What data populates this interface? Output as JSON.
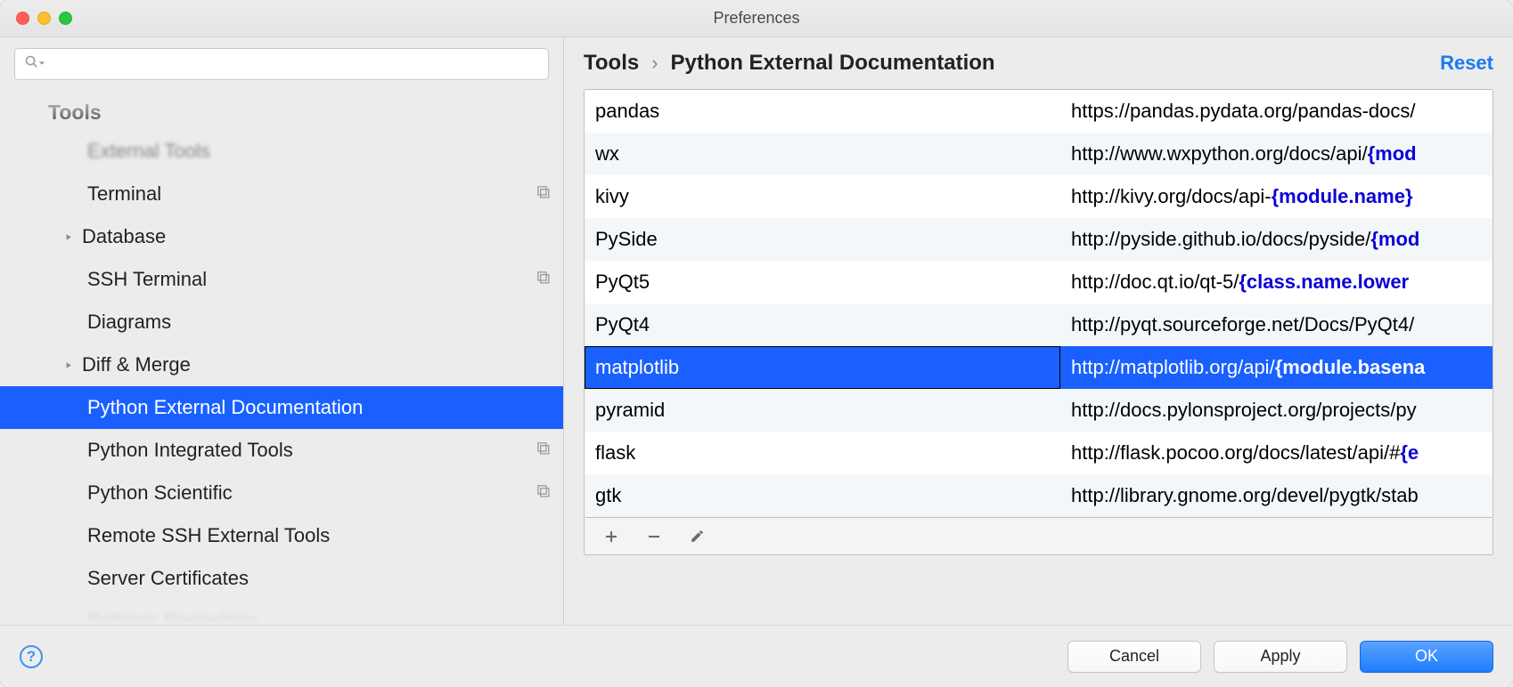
{
  "window": {
    "title": "Preferences"
  },
  "sidebar": {
    "section": "Tools",
    "items": [
      {
        "label": "External Tools",
        "depth": 2,
        "expandable": false,
        "selected": false,
        "scope": false,
        "partial": "top"
      },
      {
        "label": "Terminal",
        "depth": 2,
        "expandable": false,
        "selected": false,
        "scope": true
      },
      {
        "label": "Database",
        "depth": 2,
        "expandable": true,
        "selected": false,
        "scope": false
      },
      {
        "label": "SSH Terminal",
        "depth": 2,
        "expandable": false,
        "selected": false,
        "scope": true
      },
      {
        "label": "Diagrams",
        "depth": 2,
        "expandable": false,
        "selected": false,
        "scope": false
      },
      {
        "label": "Diff & Merge",
        "depth": 2,
        "expandable": true,
        "selected": false,
        "scope": false
      },
      {
        "label": "Python External Documentation",
        "depth": 2,
        "expandable": false,
        "selected": true,
        "scope": false
      },
      {
        "label": "Python Integrated Tools",
        "depth": 2,
        "expandable": false,
        "selected": false,
        "scope": true
      },
      {
        "label": "Python Scientific",
        "depth": 2,
        "expandable": false,
        "selected": false,
        "scope": true
      },
      {
        "label": "Remote SSH External Tools",
        "depth": 2,
        "expandable": false,
        "selected": false,
        "scope": false
      },
      {
        "label": "Server Certificates",
        "depth": 2,
        "expandable": false,
        "selected": false,
        "scope": false
      },
      {
        "label": "Settings Repository",
        "depth": 2,
        "expandable": false,
        "selected": false,
        "scope": false,
        "partial": "bottom"
      }
    ]
  },
  "breadcrumb": {
    "root": "Tools",
    "leaf": "Python External Documentation",
    "reset": "Reset",
    "separator": "›"
  },
  "table": {
    "selected_index": 6,
    "rows": [
      {
        "name": "pandas",
        "url_prefix": "https://pandas.pydata.org/pandas-docs/",
        "url_var": "",
        "url_suffix": ""
      },
      {
        "name": "wx",
        "url_prefix": "http://www.wxpython.org/docs/api/",
        "url_var": "{mod",
        "url_suffix": ""
      },
      {
        "name": "kivy",
        "url_prefix": "http://kivy.org/docs/api-",
        "url_var": "{module.name}",
        "url_suffix": ""
      },
      {
        "name": "PySide",
        "url_prefix": "http://pyside.github.io/docs/pyside/",
        "url_var": "{mod",
        "url_suffix": ""
      },
      {
        "name": "PyQt5",
        "url_prefix": "http://doc.qt.io/qt-5/",
        "url_var": "{class.name.lower",
        "url_suffix": ""
      },
      {
        "name": "PyQt4",
        "url_prefix": "http://pyqt.sourceforge.net/Docs/PyQt4/",
        "url_var": "",
        "url_suffix": ""
      },
      {
        "name": "matplotlib",
        "url_prefix": "http://matplotlib.org/api/",
        "url_var": "{module.basena",
        "url_suffix": ""
      },
      {
        "name": "pyramid",
        "url_prefix": "http://docs.pylonsproject.org/projects/py",
        "url_var": "",
        "url_suffix": ""
      },
      {
        "name": "flask",
        "url_prefix": "http://flask.pocoo.org/docs/latest/api/#",
        "url_var": "{e",
        "url_suffix": ""
      },
      {
        "name": "gtk",
        "url_prefix": "http://library.gnome.org/devel/pygtk/stab",
        "url_var": "",
        "url_suffix": ""
      }
    ]
  },
  "footer": {
    "help": "?",
    "cancel": "Cancel",
    "apply": "Apply",
    "ok": "OK"
  }
}
